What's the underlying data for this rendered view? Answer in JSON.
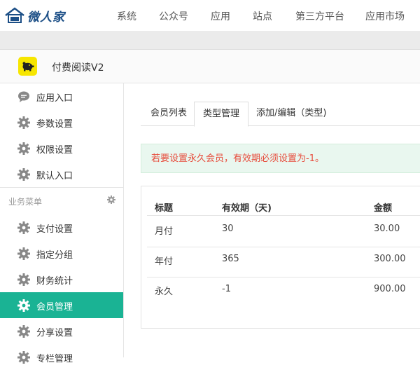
{
  "brand": {
    "name": "微人家"
  },
  "topnav": [
    "系统",
    "公众号",
    "应用",
    "站点",
    "第三方平台",
    "应用市场"
  ],
  "app": {
    "title": "付费阅读V2"
  },
  "sidebar": {
    "items_top": [
      {
        "label": "应用入口",
        "icon": "chat-bubble-icon"
      },
      {
        "label": "参数设置",
        "icon": "gear-icon"
      },
      {
        "label": "权限设置",
        "icon": "gear-icon"
      },
      {
        "label": "默认入口",
        "icon": "gear-icon"
      }
    ],
    "section_label": "业务菜单",
    "items_business": [
      {
        "label": "支付设置",
        "icon": "gear-icon"
      },
      {
        "label": "指定分组",
        "icon": "gear-icon"
      },
      {
        "label": "财务统计",
        "icon": "gear-icon"
      },
      {
        "label": "会员管理",
        "icon": "gear-icon",
        "active": true
      },
      {
        "label": "分享设置",
        "icon": "gear-icon"
      },
      {
        "label": "专栏管理",
        "icon": "gear-icon"
      }
    ]
  },
  "tabs": [
    {
      "label": "会员列表"
    },
    {
      "label": "类型管理",
      "active": true
    },
    {
      "label": "添加/编辑（类型)"
    }
  ],
  "alert": {
    "text": "若要设置永久会员，有效期必须设置为-1。"
  },
  "table": {
    "headers": [
      "标题",
      "有效期（天)",
      "金额"
    ],
    "rows": [
      [
        "月付",
        "30",
        "30.00"
      ],
      [
        "年付",
        "365",
        "300.00"
      ],
      [
        "永久",
        "-1",
        "900.00"
      ]
    ]
  },
  "colors": {
    "accent": "#1ab394",
    "alert_text": "#e74c3c",
    "alert_bg": "#e9f7ef",
    "brand": "#1b4e86"
  }
}
